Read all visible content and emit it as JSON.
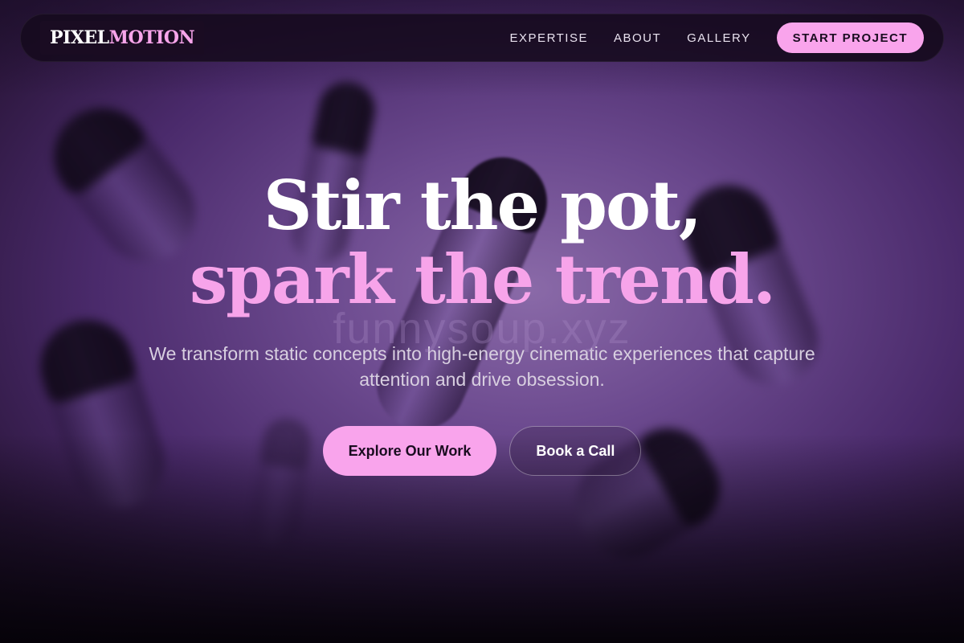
{
  "brand": {
    "logo_part1": "PIXEL",
    "logo_part2": "MOTION",
    "accent_color": "#f9a4ec"
  },
  "nav": {
    "links": [
      "EXPERTISE",
      "ABOUT",
      "GALLERY"
    ],
    "cta_label": "START PROJECT"
  },
  "hero": {
    "headline_line1": "Stir the pot,",
    "headline_line2": "spark the trend.",
    "watermark": "funnysoup.xyz",
    "subtext": "We transform static concepts into high-energy cinematic experiences that capture attention and drive obsession.",
    "primary_button": "Explore Our Work",
    "secondary_button": "Book a Call"
  }
}
